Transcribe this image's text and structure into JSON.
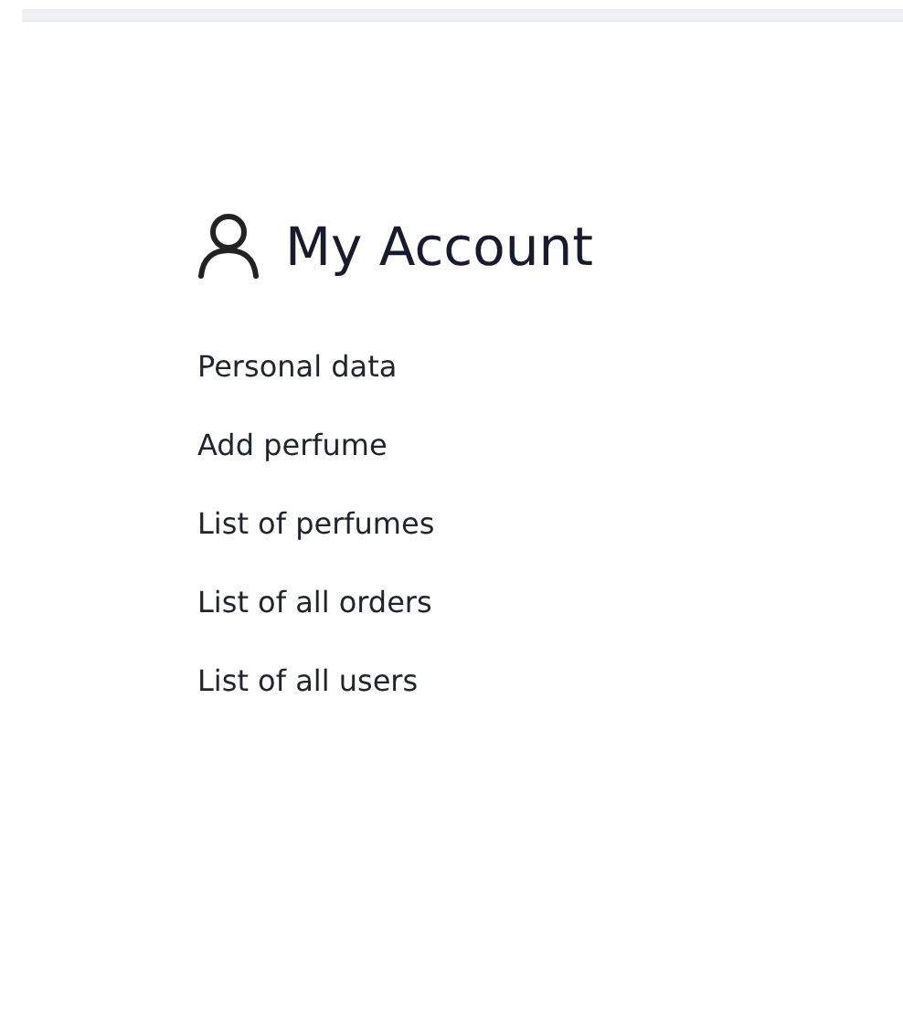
{
  "title": "My Account",
  "links": [
    "Personal data",
    "Add perfume",
    "List of perfumes",
    "List of all orders",
    "List of all users"
  ]
}
